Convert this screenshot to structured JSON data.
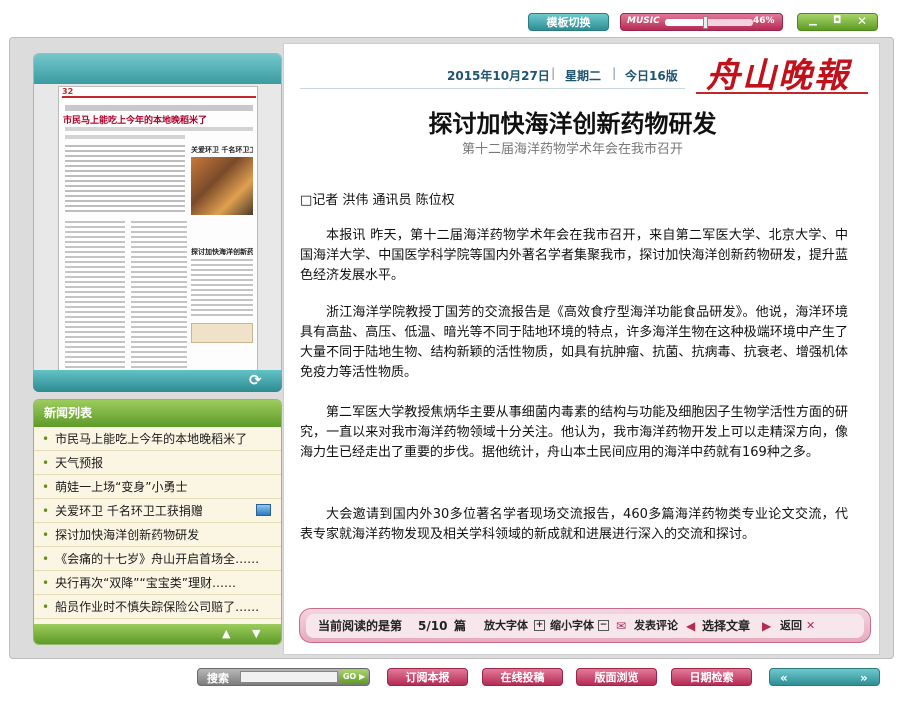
{
  "top": {
    "template_switch": "模板切换",
    "music_label": "MUSIC",
    "music_volume": "46%",
    "music_level": 0.46
  },
  "masthead": {
    "date": "2015年10月27日",
    "weekday": "星期二",
    "edition": "今日16版",
    "logo": "舟山晚報"
  },
  "thumbnail": {
    "page_label": "32",
    "headline1": "市民马上能吃上今年的本地晚稻米了",
    "headline2": "关爱环卫 千名环卫工获捐赠",
    "headline3": "探讨加快海洋创新药物研发"
  },
  "news_list": {
    "header": "新闻列表",
    "items": [
      "市民马上能吃上今年的本地晚稻米了",
      "天气预报",
      "萌娃一上场“变身”小勇士",
      "关爱环卫  千名环卫工获捐赠",
      "探讨加快海洋创新药物研发",
      "《会痛的十七岁》舟山开启首场全……",
      "央行再次“双降”“宝宝类”理财……",
      "船员作业时不慎失踪保险公司赔了……"
    ]
  },
  "article": {
    "title": "探讨加快海洋创新药物研发",
    "subtitle": "第十二届海洋药物学术年会在我市召开",
    "byline": "□记者  洪伟  通讯员  陈位权",
    "paragraphs": [
      "本报讯   昨天，第十二届海洋药物学术年会在我市召开，来自第二军医大学、北京大学、中国海洋大学、中国医学科学院等国内外著名学者集聚我市，探讨加快海洋创新药物研发，提升蓝色经济发展水平。",
      "浙江海洋学院教授丁国芳的交流报告是《高效食疗型海洋功能食品研发》。他说，海洋环境具有高盐、高压、低温、暗光等不同于陆地环境的特点，许多海洋生物在这种极端环境中产生了大量不同于陆地生物、结构新颖的活性物质，如具有抗肿瘤、抗菌、抗病毒、抗衰老、增强机体免疫力等活性物质。",
      "第二军医大学教授焦炳华主要从事细菌内毒素的结构与功能及细胞因子生物学活性方面的研究，一直以来对我市海洋药物领域十分关注。他认为，我市海洋药物开发上可以走精深方向，像海力生已经走出了重要的步伐。据他统计，舟山本土民间应用的海洋中药就有169种之多。",
      "大会邀请到国内外30多位著名学者现场交流报告，460多篇海洋药物类专业论文交流，代表专家就海洋药物发现及相关学科领域的新成就和进展进行深入的交流和探讨。"
    ]
  },
  "reading_bar": {
    "current_label": "当前阅读的是第",
    "position": "5/10",
    "unit": "篇",
    "bigger_font": "放大字体",
    "smaller_font": "缩小字体",
    "comment": "发表评论",
    "select": "选择文章",
    "back": "返回"
  },
  "bottom": {
    "search_label": "搜索",
    "go": "GO",
    "subscribe": "订阅本报",
    "submit": "在线投稿",
    "browse": "版面浏览",
    "date_search": "日期检索"
  }
}
